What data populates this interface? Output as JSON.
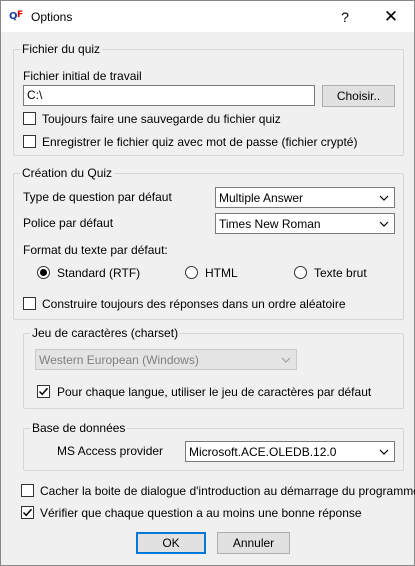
{
  "window": {
    "title": "Options",
    "help_glyph": "?",
    "close_glyph": "✕"
  },
  "quiz_file": {
    "legend": "Fichier du quiz",
    "initial_file_label": "Fichier initial de travail",
    "initial_file_value": "C:\\",
    "choose_button": "Choisir..",
    "always_backup": {
      "label": "Toujours faire une sauvegarde du fichier quiz",
      "checked": false
    },
    "save_with_password": {
      "label": "Enregistrer le fichier quiz avec mot de passe (fichier crypté)",
      "checked": false
    }
  },
  "quiz_creation": {
    "legend": "Création du Quiz",
    "default_question_type_label": "Type de question par défaut",
    "default_question_type_value": "Multiple Answer",
    "default_font_label": "Police par défaut",
    "default_font_value": "Times New Roman",
    "text_format_label": "Format du texte par défaut:",
    "formats": [
      {
        "label": "Standard (RTF)",
        "selected": true
      },
      {
        "label": "HTML",
        "selected": false
      },
      {
        "label": "Texte brut",
        "selected": false
      }
    ],
    "random_order": {
      "label": "Construire toujours des réponses dans un ordre aléatoire",
      "checked": false
    }
  },
  "charset": {
    "legend": "Jeu de  caractères (charset)",
    "value": "Western European (Windows)",
    "per_language_default": {
      "label": "Pour chaque langue, utiliser le jeu de caractères par défaut",
      "checked": true
    }
  },
  "database": {
    "legend": "Base de données",
    "provider_label": "MS Access provider",
    "provider_value": "Microsoft.ACE.OLEDB.12.0"
  },
  "hide_intro": {
    "label": "Cacher la boite de  dialogue d'introduction au démarrage du programme",
    "checked": false
  },
  "verify_correct": {
    "label": "Vérifier que chaque question a au moins une bonne réponse",
    "checked": true
  },
  "buttons": {
    "ok": "OK",
    "cancel": "Annuler"
  },
  "colors": {
    "accent": "#0078d7",
    "background": "#f0f0f0"
  }
}
